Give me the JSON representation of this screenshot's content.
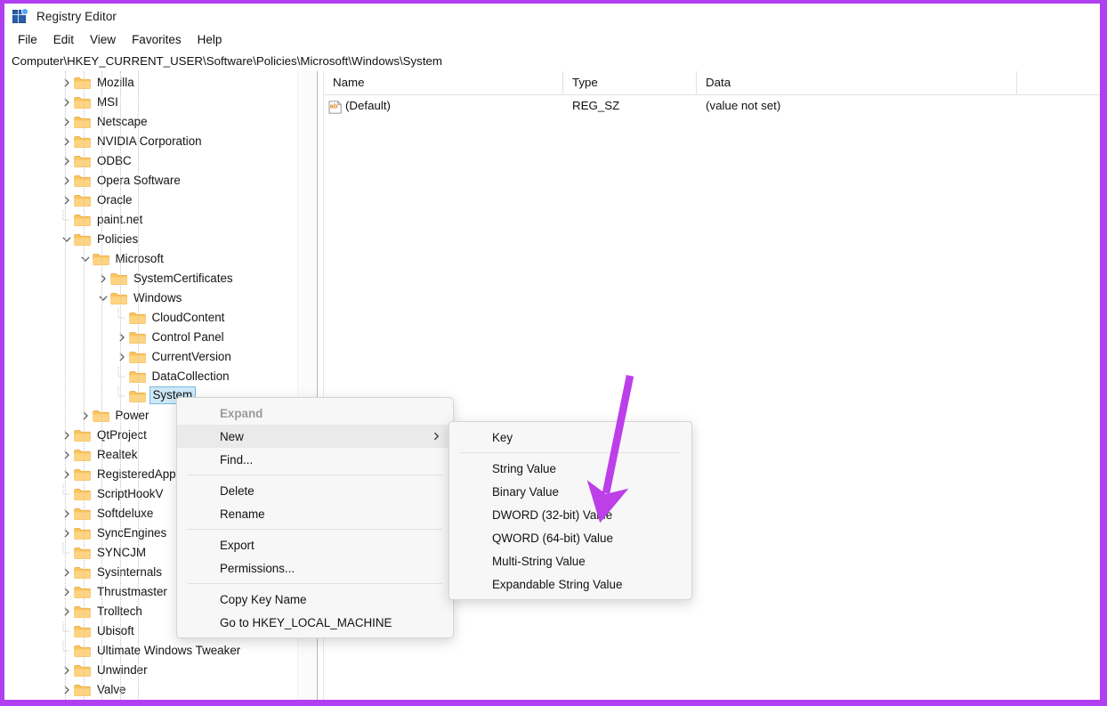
{
  "window": {
    "title": "Registry Editor",
    "icon": "registry-editor-icon",
    "border_color": "#b03ff0"
  },
  "menubar": {
    "items": [
      {
        "label": "File"
      },
      {
        "label": "Edit"
      },
      {
        "label": "View"
      },
      {
        "label": "Favorites"
      },
      {
        "label": "Help"
      }
    ]
  },
  "address_bar": {
    "path": "Computer\\HKEY_CURRENT_USER\\Software\\Policies\\Microsoft\\Windows\\System"
  },
  "tree": {
    "items": [
      {
        "label": "Mozilla",
        "depth": 1,
        "twisty": "collapsed",
        "selected": false
      },
      {
        "label": "MSI",
        "depth": 1,
        "twisty": "collapsed",
        "selected": false
      },
      {
        "label": "Netscape",
        "depth": 1,
        "twisty": "collapsed",
        "selected": false
      },
      {
        "label": "NVIDIA Corporation",
        "depth": 1,
        "twisty": "collapsed",
        "selected": false
      },
      {
        "label": "ODBC",
        "depth": 1,
        "twisty": "collapsed",
        "selected": false
      },
      {
        "label": "Opera Software",
        "depth": 1,
        "twisty": "collapsed",
        "selected": false
      },
      {
        "label": "Oracle",
        "depth": 1,
        "twisty": "collapsed",
        "selected": false
      },
      {
        "label": "paint.net",
        "depth": 1,
        "twisty": "none",
        "selected": false
      },
      {
        "label": "Policies",
        "depth": 1,
        "twisty": "expanded",
        "selected": false
      },
      {
        "label": "Microsoft",
        "depth": 2,
        "twisty": "expanded",
        "selected": false
      },
      {
        "label": "SystemCertificates",
        "depth": 3,
        "twisty": "collapsed",
        "selected": false
      },
      {
        "label": "Windows",
        "depth": 3,
        "twisty": "expanded",
        "selected": false
      },
      {
        "label": "CloudContent",
        "depth": 4,
        "twisty": "none",
        "selected": false
      },
      {
        "label": "Control Panel",
        "depth": 4,
        "twisty": "collapsed",
        "selected": false
      },
      {
        "label": "CurrentVersion",
        "depth": 4,
        "twisty": "collapsed",
        "selected": false
      },
      {
        "label": "DataCollection",
        "depth": 4,
        "twisty": "none",
        "selected": false
      },
      {
        "label": "System",
        "depth": 4,
        "twisty": "none",
        "selected": true
      },
      {
        "label": "Power",
        "depth": 2,
        "twisty": "collapsed",
        "selected": false
      },
      {
        "label": "QtProject",
        "depth": 1,
        "twisty": "collapsed",
        "selected": false
      },
      {
        "label": "Realtek",
        "depth": 1,
        "twisty": "collapsed",
        "selected": false
      },
      {
        "label": "RegisteredApplications",
        "depth": 1,
        "twisty": "collapsed",
        "selected": false
      },
      {
        "label": "ScriptHookV",
        "depth": 1,
        "twisty": "none",
        "selected": false
      },
      {
        "label": "Softdeluxe",
        "depth": 1,
        "twisty": "collapsed",
        "selected": false
      },
      {
        "label": "SyncEngines",
        "depth": 1,
        "twisty": "collapsed",
        "selected": false
      },
      {
        "label": "SYNCJM",
        "depth": 1,
        "twisty": "none",
        "selected": false
      },
      {
        "label": "Sysinternals",
        "depth": 1,
        "twisty": "collapsed",
        "selected": false
      },
      {
        "label": "Thrustmaster",
        "depth": 1,
        "twisty": "collapsed",
        "selected": false
      },
      {
        "label": "Trolltech",
        "depth": 1,
        "twisty": "collapsed",
        "selected": false
      },
      {
        "label": "Ubisoft",
        "depth": 1,
        "twisty": "none",
        "selected": false
      },
      {
        "label": "Ultimate Windows Tweaker",
        "depth": 1,
        "twisty": "none",
        "selected": false
      },
      {
        "label": "Unwinder",
        "depth": 1,
        "twisty": "collapsed",
        "selected": false
      },
      {
        "label": "Valve",
        "depth": 1,
        "twisty": "collapsed",
        "selected": false
      }
    ]
  },
  "value_list": {
    "columns": [
      {
        "label": "Name"
      },
      {
        "label": "Type"
      },
      {
        "label": "Data"
      }
    ],
    "rows": [
      {
        "icon": "string-value-icon",
        "name": "(Default)",
        "type": "REG_SZ",
        "data": "(value not set)"
      }
    ]
  },
  "context_menu": {
    "items": [
      {
        "label": "Expand",
        "state": "disabled",
        "submenu": false
      },
      {
        "label": "New",
        "state": "highlight",
        "submenu": true
      },
      {
        "label": "Find...",
        "state": "normal",
        "submenu": false
      },
      {
        "label": "__separator__",
        "state": "separator",
        "submenu": false
      },
      {
        "label": "Delete",
        "state": "normal",
        "submenu": false
      },
      {
        "label": "Rename",
        "state": "normal",
        "submenu": false
      },
      {
        "label": "__separator__",
        "state": "separator",
        "submenu": false
      },
      {
        "label": "Export",
        "state": "normal",
        "submenu": false
      },
      {
        "label": "Permissions...",
        "state": "normal",
        "submenu": false
      },
      {
        "label": "__separator__",
        "state": "separator",
        "submenu": false
      },
      {
        "label": "Copy Key Name",
        "state": "normal",
        "submenu": false
      },
      {
        "label": "Go to HKEY_LOCAL_MACHINE",
        "state": "normal",
        "submenu": false
      }
    ]
  },
  "new_submenu": {
    "items": [
      {
        "label": "Key",
        "state": "normal"
      },
      {
        "label": "__separator__",
        "state": "separator"
      },
      {
        "label": "String Value",
        "state": "normal"
      },
      {
        "label": "Binary Value",
        "state": "normal"
      },
      {
        "label": "DWORD (32-bit) Value",
        "state": "normal"
      },
      {
        "label": "QWORD (64-bit) Value",
        "state": "normal"
      },
      {
        "label": "Multi-String Value",
        "state": "normal"
      },
      {
        "label": "Expandable String Value",
        "state": "normal"
      }
    ]
  },
  "annotation": {
    "arrow_color": "#bc3fe8",
    "points_to": "DWORD (32-bit) Value"
  }
}
